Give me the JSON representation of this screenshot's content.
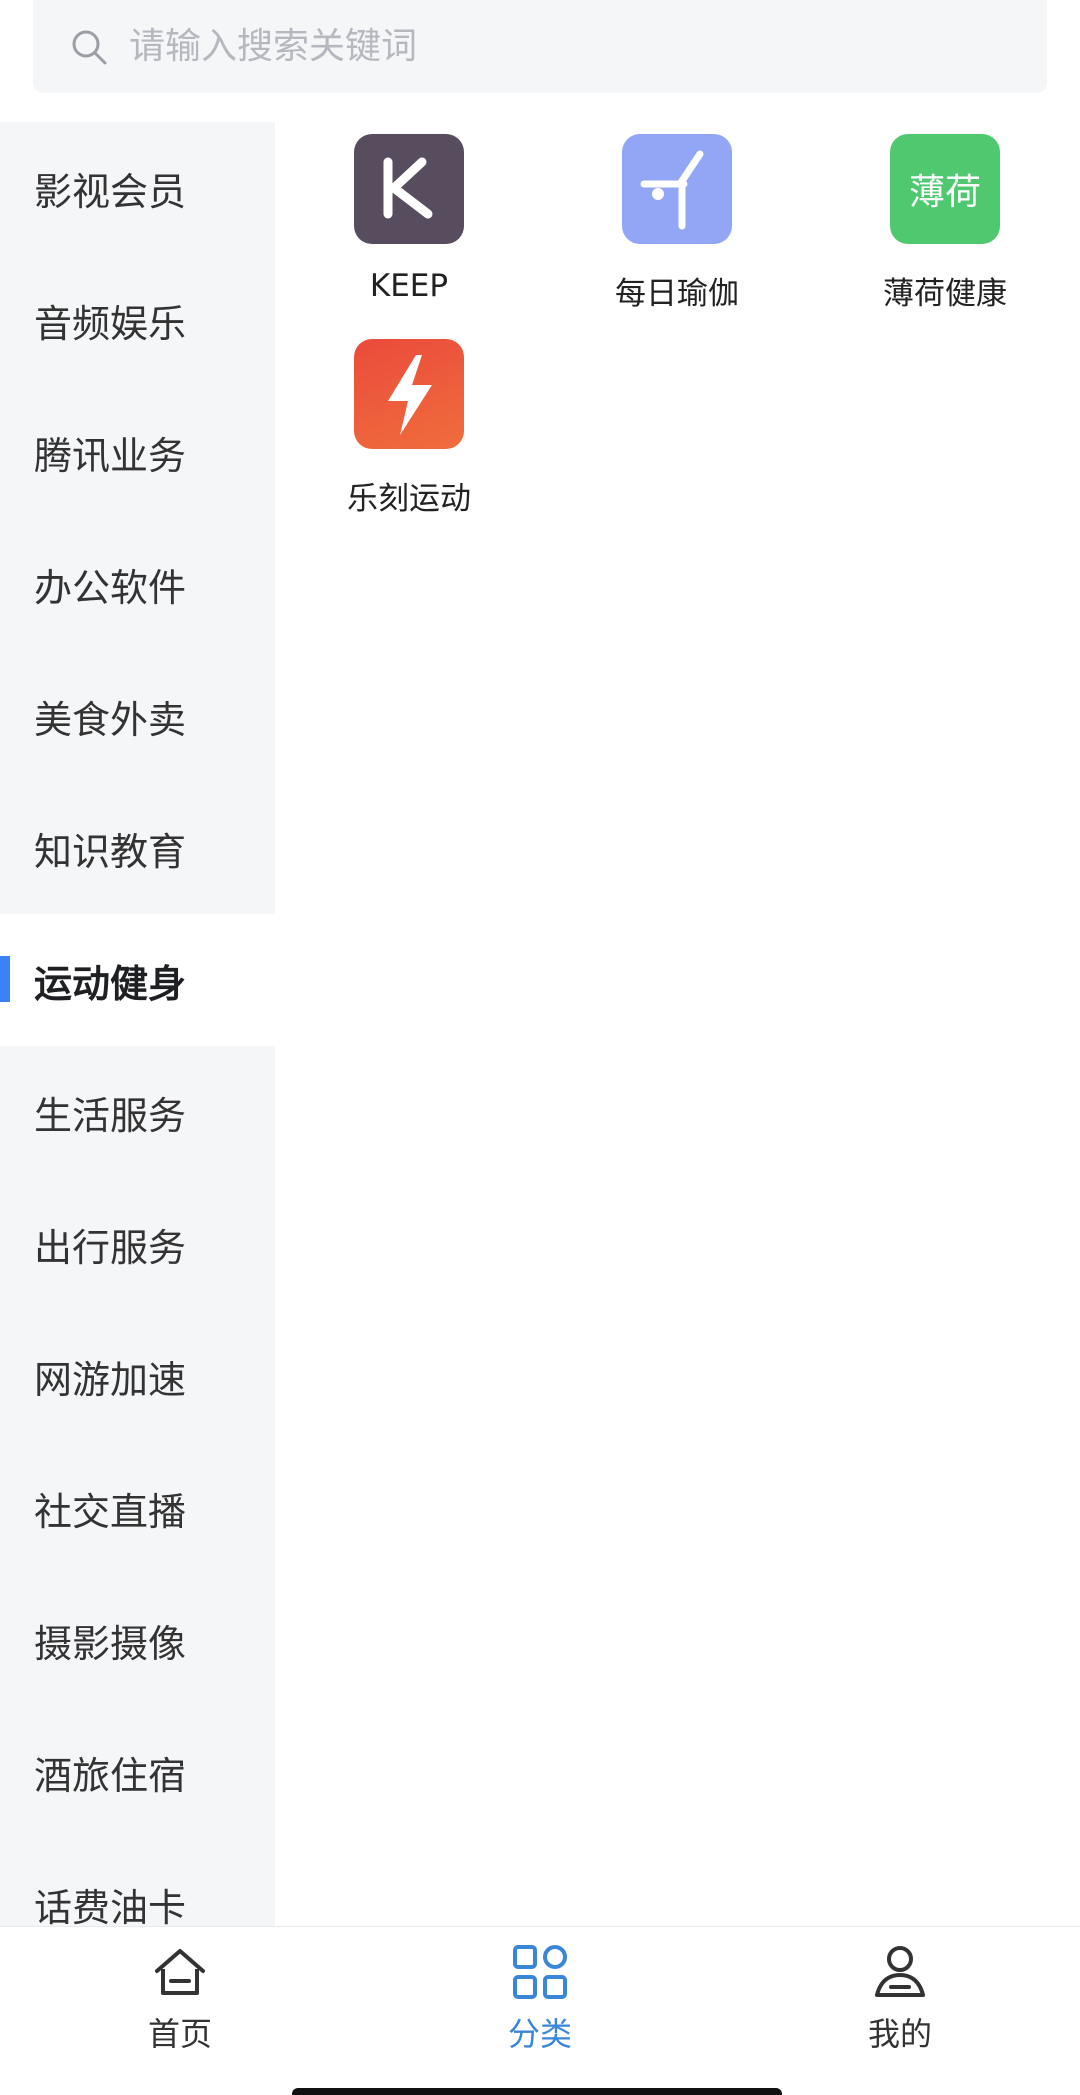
{
  "search": {
    "placeholder": "请输入搜索关键词"
  },
  "sidebar": {
    "items": [
      {
        "label": "影视会员"
      },
      {
        "label": "音频娱乐"
      },
      {
        "label": "腾讯业务"
      },
      {
        "label": "办公软件"
      },
      {
        "label": "美食外卖"
      },
      {
        "label": "知识教育"
      },
      {
        "label": "运动健身"
      },
      {
        "label": "生活服务"
      },
      {
        "label": "出行服务"
      },
      {
        "label": "网游加速"
      },
      {
        "label": "社交直播"
      },
      {
        "label": "摄影摄像"
      },
      {
        "label": "酒旅住宿"
      },
      {
        "label": "话费油卡"
      }
    ],
    "active_index": 6
  },
  "apps": [
    {
      "label": "KEEP",
      "icon": "keep-logo-icon",
      "color": "#574d5f"
    },
    {
      "label": "每日瑜伽",
      "icon": "yoga-figure-icon",
      "color": "#93a5f5"
    },
    {
      "label": "薄荷健康",
      "icon": "boohee-logo-icon",
      "icon_text": "薄荷",
      "color": "#4fc870"
    },
    {
      "label": "乐刻运动",
      "icon": "lightning-icon",
      "color": "#ec5a3f"
    }
  ],
  "bottom_nav": {
    "items": [
      {
        "label": "首页",
        "icon": "home-icon"
      },
      {
        "label": "分类",
        "icon": "category-grid-icon"
      },
      {
        "label": "我的",
        "icon": "user-icon"
      }
    ],
    "active_index": 1,
    "accent_color": "#3a86d8"
  },
  "colors": {
    "sidebar_indicator": "#3b82f6",
    "sidebar_bg": "#f5f6f8"
  }
}
